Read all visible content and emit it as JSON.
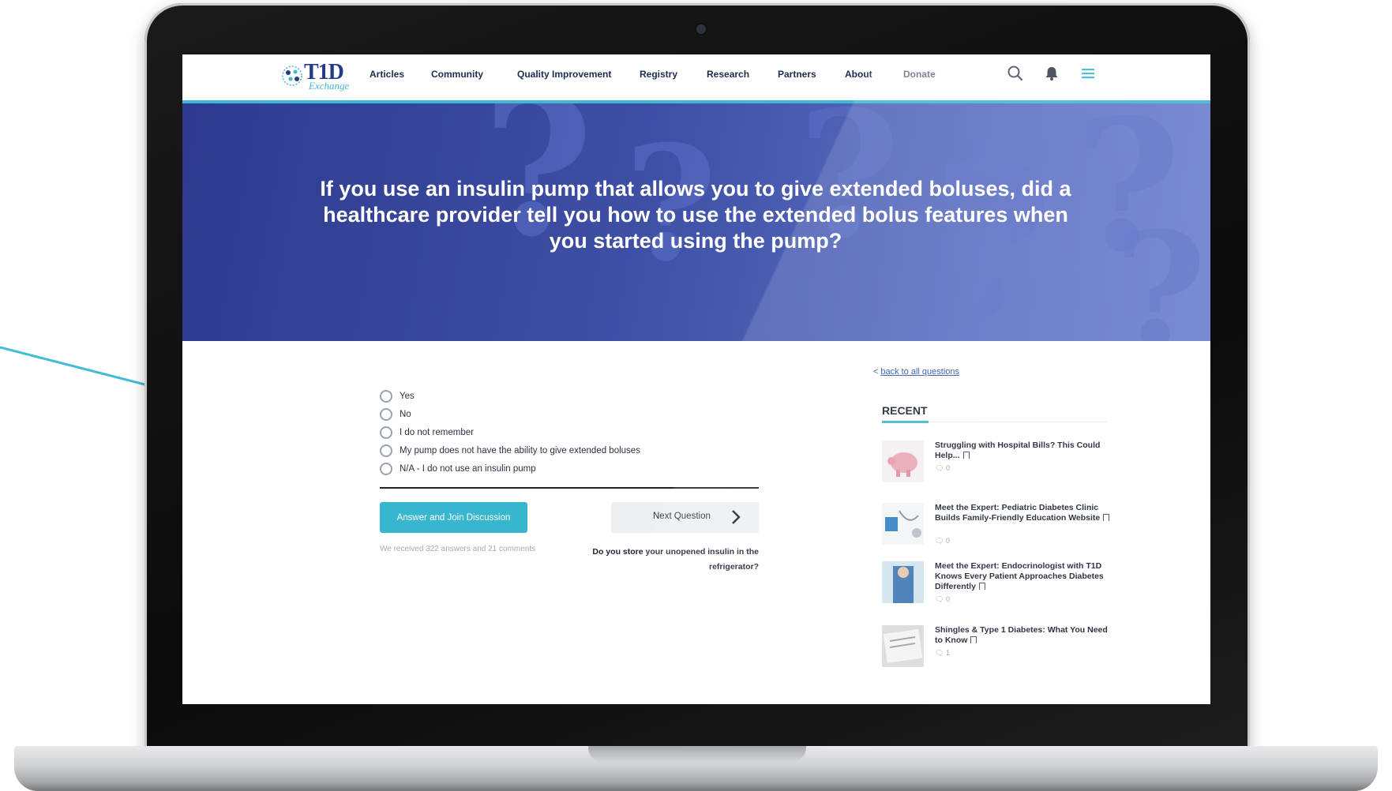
{
  "nav": {
    "logo_text": "T1D",
    "logo_subtext": "Exchange",
    "items": [
      "Articles",
      "Community",
      "Quality Improvement",
      "Registry",
      "Research",
      "Partners",
      "About",
      "Donate"
    ]
  },
  "hero": {
    "line1": "If you use an insulin pump that allows you to give extended boluses, did a",
    "line2": "healthcare provider tell you how to use the extended bolus features when",
    "line3": "you started using the pump?"
  },
  "question": {
    "back_prefix": "< ",
    "back_link": "back to all questions",
    "options": [
      "Yes",
      "No",
      "I do not remember",
      "My pump does not have the ability to give extended boluses",
      "N/A - I do not use an insulin pump"
    ],
    "answer_button": "Answer and Join Discussion",
    "next_button": "Next Question",
    "stats": "We received 322 answers and 21 comments",
    "next_question_line1": "Do you store your unopened insulin in the",
    "next_question_line2": "refrigerator?"
  },
  "sidebar": {
    "title": "RECENT",
    "items": [
      {
        "title": "Struggling with Hospital Bills? This Could Help...",
        "comments": "0"
      },
      {
        "title": "Meet the Expert: Pediatric Diabetes Clinic Builds Family-Friendly Education Website",
        "comments": "0"
      },
      {
        "title": "Meet the Expert: Endocrinologist with T1D Knows Every Patient Approaches Diabetes Differently",
        "comments": "0"
      },
      {
        "title": "Shingles & Type 1 Diabetes: What You Need to Know",
        "comments": "1"
      }
    ]
  },
  "colors": {
    "accent": "#3fb8d3",
    "brand_navy": "#243b87",
    "hero_blue": "#3e4fa6"
  }
}
